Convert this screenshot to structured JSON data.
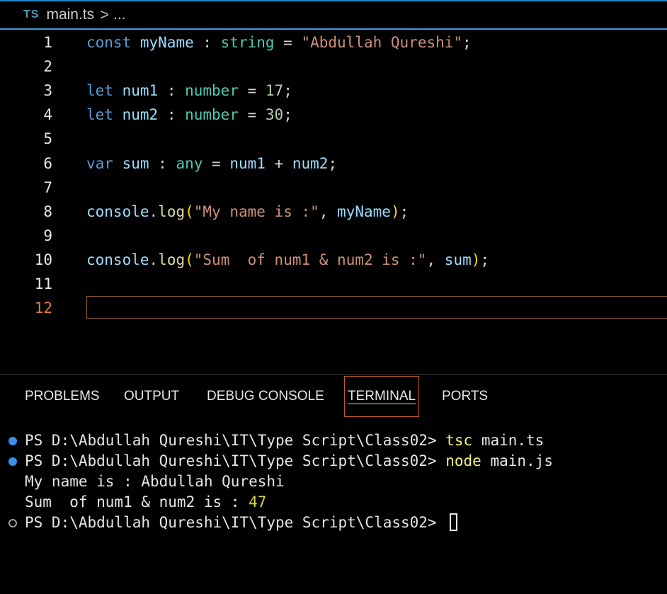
{
  "breadcrumb": {
    "lang_badge": "TS",
    "file": "main.ts",
    "separator": ">",
    "ellipsis": "..."
  },
  "editor": {
    "active_line": 12,
    "lines": [
      {
        "no": "1",
        "tokens": [
          [
            "kw",
            "const"
          ],
          [
            "op",
            " "
          ],
          [
            "var",
            "myName"
          ],
          [
            "op",
            " : "
          ],
          [
            "type",
            "string"
          ],
          [
            "op",
            " = "
          ],
          [
            "str",
            "\"Abdullah Qureshi\""
          ],
          [
            "op",
            ";"
          ]
        ]
      },
      {
        "no": "2",
        "tokens": []
      },
      {
        "no": "3",
        "tokens": [
          [
            "kw",
            "let"
          ],
          [
            "op",
            " "
          ],
          [
            "var",
            "num1"
          ],
          [
            "op",
            " : "
          ],
          [
            "type",
            "number"
          ],
          [
            "op",
            " = "
          ],
          [
            "num",
            "17"
          ],
          [
            "op",
            ";"
          ]
        ]
      },
      {
        "no": "4",
        "tokens": [
          [
            "kw",
            "let"
          ],
          [
            "op",
            " "
          ],
          [
            "var",
            "num2"
          ],
          [
            "op",
            " : "
          ],
          [
            "type",
            "number"
          ],
          [
            "op",
            " = "
          ],
          [
            "num",
            "30"
          ],
          [
            "op",
            ";"
          ]
        ]
      },
      {
        "no": "5",
        "tokens": []
      },
      {
        "no": "6",
        "tokens": [
          [
            "kw",
            "var"
          ],
          [
            "op",
            " "
          ],
          [
            "var",
            "sum"
          ],
          [
            "op",
            " : "
          ],
          [
            "type",
            "any"
          ],
          [
            "op",
            " = "
          ],
          [
            "var",
            "num1"
          ],
          [
            "op",
            " + "
          ],
          [
            "var",
            "num2"
          ],
          [
            "op",
            ";"
          ]
        ]
      },
      {
        "no": "7",
        "tokens": []
      },
      {
        "no": "8",
        "tokens": [
          [
            "var",
            "console"
          ],
          [
            "op",
            "."
          ],
          [
            "fn",
            "log"
          ],
          [
            "brace",
            "("
          ],
          [
            "str",
            "\"My name is :\""
          ],
          [
            "op",
            ", "
          ],
          [
            "var",
            "myName"
          ],
          [
            "brace",
            ")"
          ],
          [
            "op",
            ";"
          ]
        ]
      },
      {
        "no": "9",
        "tokens": []
      },
      {
        "no": "10",
        "tokens": [
          [
            "var",
            "console"
          ],
          [
            "op",
            "."
          ],
          [
            "fn",
            "log"
          ],
          [
            "brace",
            "("
          ],
          [
            "str",
            "\"Sum  of num1 & num2 is :\""
          ],
          [
            "op",
            ", "
          ],
          [
            "var",
            "sum"
          ],
          [
            "brace",
            ")"
          ],
          [
            "op",
            ";"
          ]
        ]
      },
      {
        "no": "11",
        "tokens": []
      },
      {
        "no": "12",
        "tokens": []
      }
    ]
  },
  "panel": {
    "tabs": [
      {
        "label": "PROBLEMS"
      },
      {
        "label": "OUTPUT"
      },
      {
        "label": "DEBUG CONSOLE"
      },
      {
        "label": "TERMINAL",
        "active": true
      },
      {
        "label": "PORTS"
      }
    ]
  },
  "terminal": {
    "prompt": "PS D:\\Abdullah Qureshi\\IT\\Type Script\\Class02> ",
    "lines": [
      {
        "dot": "filled",
        "prompt": true,
        "cmd": "tsc",
        "args": " main.ts"
      },
      {
        "dot": "filled",
        "prompt": true,
        "cmd": "node",
        "args": " main.js"
      },
      {
        "dot": "none",
        "prompt": false,
        "text": "My name is : Abdullah Qureshi"
      },
      {
        "dot": "none",
        "prompt": false,
        "text": "Sum  of num1 & num2 is : ",
        "num": "47"
      },
      {
        "dot": "hollow",
        "prompt": true,
        "cursor": true
      }
    ]
  },
  "colors": {
    "keyword": "#569cd6",
    "variable": "#9cdcfe",
    "type": "#4ec9b0",
    "string": "#ce9178",
    "number": "#b5cea8",
    "function": "#dcdcaa",
    "active_line_number": "#e07b39",
    "terminal_dot": "#3b8eea"
  }
}
